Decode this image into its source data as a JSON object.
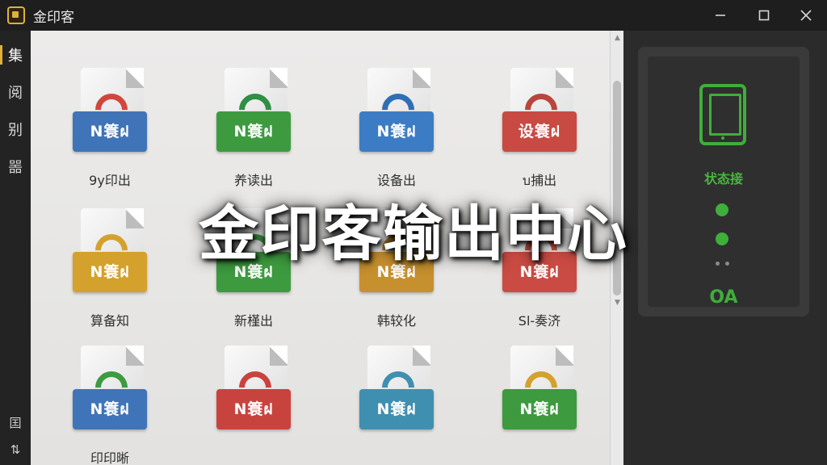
{
  "app": {
    "title": "金印客"
  },
  "titlebar": {
    "minimize": "minimize-icon",
    "maximize": "maximize-icon",
    "close": "close-icon"
  },
  "rail": {
    "items": [
      {
        "label": "集",
        "active": true
      },
      {
        "label": "阅",
        "active": false
      },
      {
        "label": "别",
        "active": false
      },
      {
        "label": "噐",
        "active": false
      }
    ],
    "bottom": [
      {
        "label": "囯"
      },
      {
        "label": "⇅"
      }
    ]
  },
  "files": [
    {
      "badge": "N簑ฝ",
      "label": "9y印出",
      "color": "#3f74b8",
      "arc": "#d0463c"
    },
    {
      "badge": "N簑ฝ",
      "label": "养读出",
      "color": "#3d9a3f",
      "arc": "#2f8f44"
    },
    {
      "badge": "N簑ฝ",
      "label": "设备出",
      "color": "#3c7cc4",
      "arc": "#2f6fb5"
    },
    {
      "badge": "设簑ฝ",
      "label": "บ捕出",
      "color": "#c84a42",
      "arc": "#b9453d"
    },
    {
      "badge": "N簑ฝ",
      "label": "算备知",
      "color": "#d4a12c",
      "arc": "#d4a12c"
    },
    {
      "badge": "N簑ฝ",
      "label": "新槿出",
      "color": "#3d9a3f",
      "arc": "#3d9a3f"
    },
    {
      "badge": "N簑ฝ",
      "label": "韩较化",
      "color": "#c7902e",
      "arc": "#c7902e"
    },
    {
      "badge": "N簑ฝ",
      "label": "Sl-奏济",
      "color": "#c94b43",
      "arc": "#c94b43"
    },
    {
      "badge": "N簑ฝ",
      "label": "印印晰",
      "color": "#3f74b8",
      "arc": "#3d9a3f"
    },
    {
      "badge": "N簑ฝ",
      "label": "",
      "color": "#c9433e",
      "arc": "#c9433e"
    },
    {
      "badge": "N簑ฝ",
      "label": "",
      "color": "#3f8fb0",
      "arc": "#3f8fb0"
    },
    {
      "badge": "N簑ฝ",
      "label": "",
      "color": "#3d9a3f",
      "arc": "#d4a12c"
    }
  ],
  "status": {
    "title": "状态接",
    "ok": "OA",
    "accent": "#3fae3a"
  },
  "overlay": {
    "title": "金印客输出中心"
  }
}
